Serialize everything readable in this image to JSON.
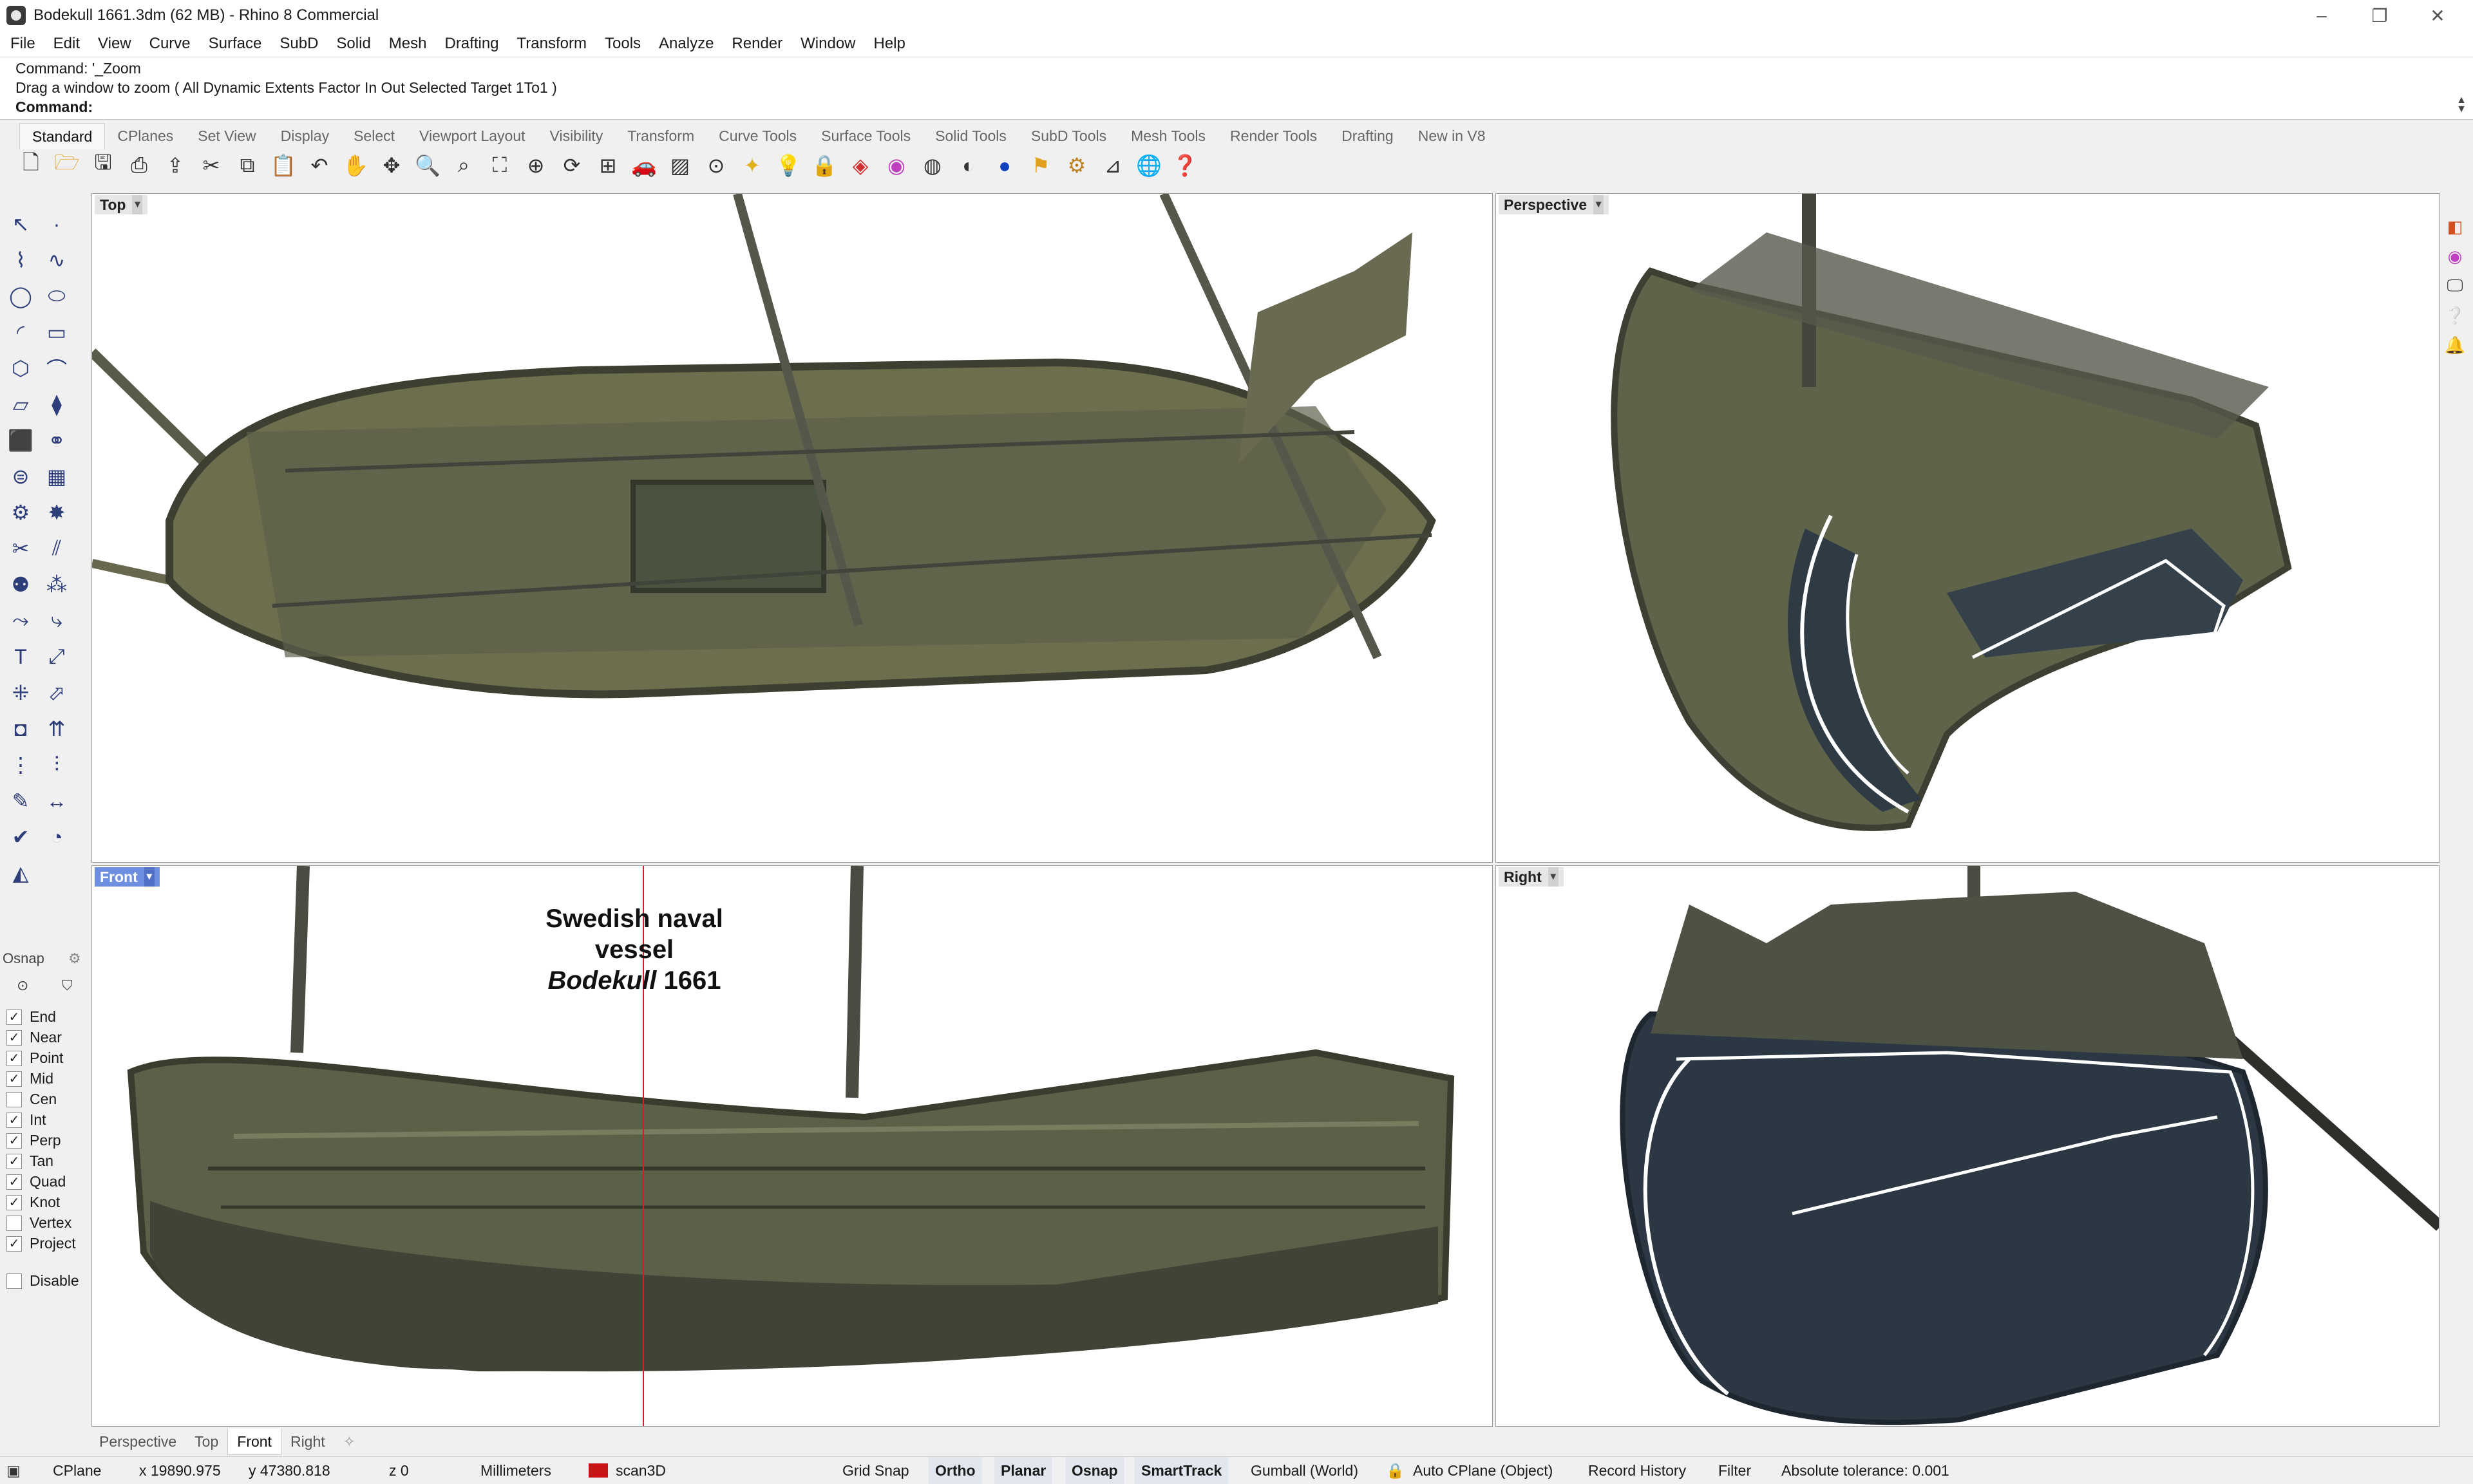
{
  "window": {
    "title": "Bodekull 1661.3dm (62 MB) - Rhino 8 Commercial",
    "controls": [
      "–",
      "❐",
      "✕"
    ]
  },
  "menu": [
    "File",
    "Edit",
    "View",
    "Curve",
    "Surface",
    "SubD",
    "Solid",
    "Mesh",
    "Drafting",
    "Transform",
    "Tools",
    "Analyze",
    "Render",
    "Window",
    "Help"
  ],
  "command": {
    "history_1": "Command: '_Zoom",
    "history_2": "Drag a window to zoom ( All  Dynamic  Extents  Factor  In  Out  Selected  Target  1To1 )",
    "prompt": "Command:"
  },
  "toolbar_tabs": [
    "Standard",
    "CPlanes",
    "Set View",
    "Display",
    "Select",
    "Viewport Layout",
    "Visibility",
    "Transform",
    "Curve Tools",
    "Surface Tools",
    "Solid Tools",
    "SubD Tools",
    "Mesh Tools",
    "Render Tools",
    "Drafting",
    "New in V8"
  ],
  "toolbar_icons": [
    "new-icon",
    "open-icon",
    "save-icon",
    "print-icon",
    "import-icon",
    "cut-icon",
    "copy-icon",
    "paste-icon",
    "undo-icon",
    "pan-icon",
    "rotate-view-icon",
    "zoom-icon",
    "zoom-window-icon",
    "zoom-extents-icon",
    "zoom-selected-icon",
    "rotate-icon",
    "grid-icon",
    "car-icon",
    "hatch-icon",
    "cplane-icon",
    "light-icon",
    "bulb-icon",
    "lock-icon",
    "layers-icon",
    "color-wheel-icon",
    "sphere-wire-icon",
    "sphere-shaded-icon",
    "render-sphere-icon",
    "select-filter-icon",
    "settings-icon",
    "dimension-icon",
    "globe-icon",
    "help-icon"
  ],
  "viewports": {
    "top": {
      "label": "Top"
    },
    "perspective": {
      "label": "Perspective"
    },
    "front": {
      "label": "Front",
      "caption_line1": "Swedish naval vessel",
      "caption_italic": "Bodekull",
      "caption_year": " 1661"
    },
    "right": {
      "label": "Right"
    }
  },
  "osnap": {
    "title": "Osnap",
    "items": [
      {
        "label": "End",
        "checked": true
      },
      {
        "label": "Near",
        "checked": true
      },
      {
        "label": "Point",
        "checked": true
      },
      {
        "label": "Mid",
        "checked": true
      },
      {
        "label": "Cen",
        "checked": false
      },
      {
        "label": "Int",
        "checked": true
      },
      {
        "label": "Perp",
        "checked": true
      },
      {
        "label": "Tan",
        "checked": true
      },
      {
        "label": "Quad",
        "checked": true
      },
      {
        "label": "Knot",
        "checked": true
      },
      {
        "label": "Vertex",
        "checked": false
      },
      {
        "label": "Project",
        "checked": true
      }
    ],
    "disable": {
      "label": "Disable",
      "checked": false
    }
  },
  "viewport_tabs": [
    "Perspective",
    "Top",
    "Front",
    "Right"
  ],
  "status": {
    "cplane": "CPlane",
    "x": "x 19890.975",
    "y": "y 47380.818",
    "z": "z 0",
    "units": "Millimeters",
    "layer": "scan3D",
    "layer_color": "#c81414",
    "grid_snap": "Grid Snap",
    "ortho": "Ortho",
    "planar": "Planar",
    "osnap": "Osnap",
    "smarttrack": "SmartTrack",
    "gumball": "Gumball (World)",
    "auto_cplane": "Auto CPlane (Object)",
    "record_history": "Record History",
    "filter": "Filter",
    "tolerance": "Absolute tolerance: 0.001"
  },
  "colors": {
    "accent": "#6e8fe0",
    "hull": "#6b6e4c",
    "hull_dark": "#3e4230",
    "hull_shadow": "#2f3a44"
  }
}
